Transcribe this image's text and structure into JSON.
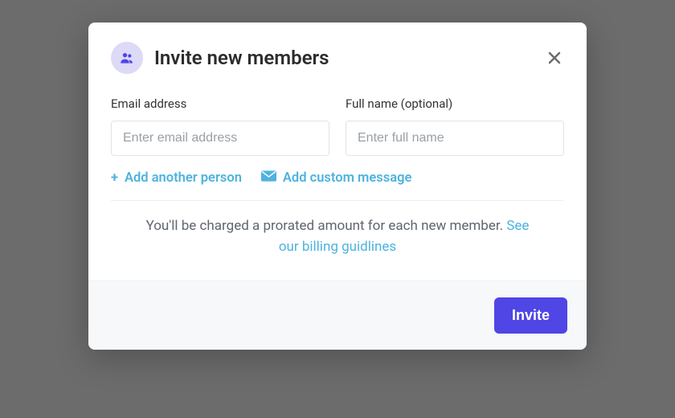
{
  "modal": {
    "title": "Invite new members",
    "close_icon": "close",
    "header_icon": "people"
  },
  "fields": {
    "email": {
      "label": "Email address",
      "placeholder": "Enter email address",
      "value": ""
    },
    "name": {
      "label": "Full name (optional)",
      "placeholder": "Enter full name",
      "value": ""
    }
  },
  "actions": {
    "add_person": "Add another person",
    "add_person_prefix": "+ ",
    "add_message": "Add custom message",
    "add_message_icon": "envelope"
  },
  "notice": {
    "text": "You'll be charged a prorated amount for each new member. ",
    "link": "See our billing guidlines"
  },
  "footer": {
    "invite": "Invite"
  },
  "colors": {
    "accent": "#4f46e5",
    "link": "#4db3de",
    "icon_bg": "#dcdaf7"
  }
}
